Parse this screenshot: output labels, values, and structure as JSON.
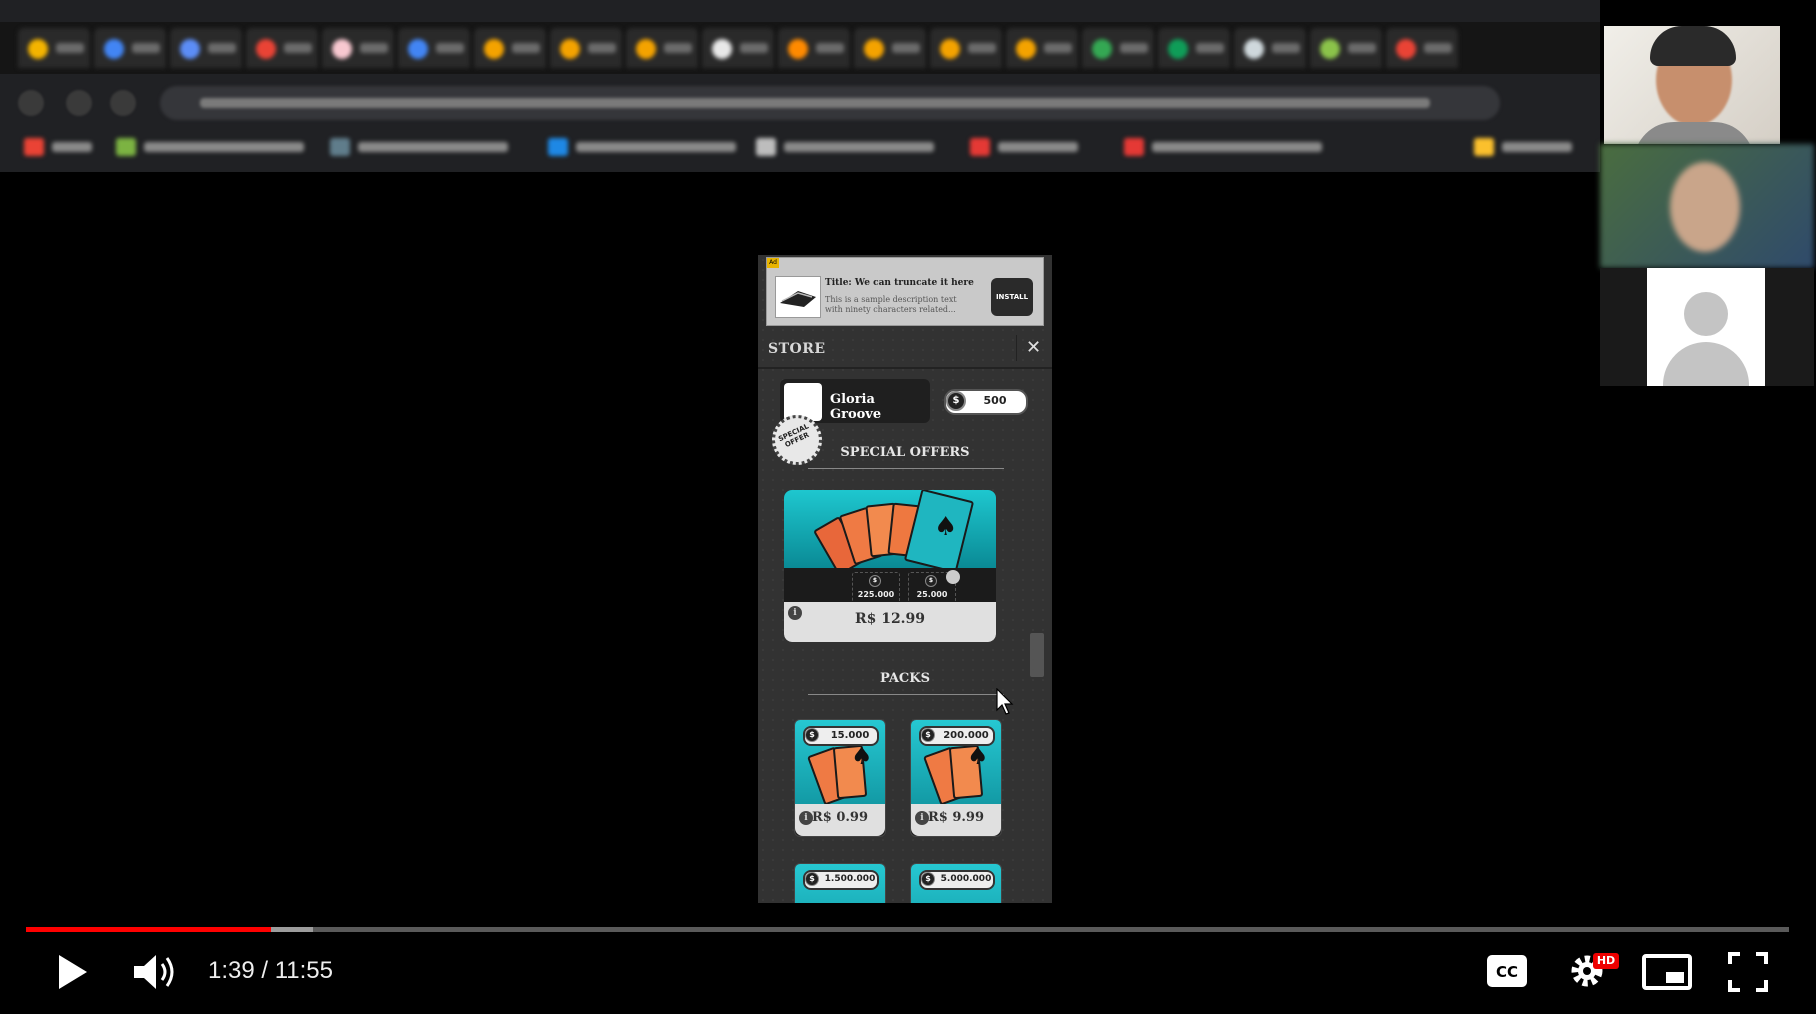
{
  "ad": {
    "badge": "Ad",
    "title": "Title: We can truncate it here",
    "description": "This is a sample description text with ninety characters related...",
    "install_label": "INSTALL"
  },
  "store": {
    "title": "STORE",
    "close_icon": "close-icon"
  },
  "profile": {
    "name": "Gloria Groove",
    "coins": "500"
  },
  "special_offers": {
    "title": "SPECIAL OFFERS",
    "badge": "SPECIAL OFFER",
    "items": [
      {
        "amount": "225.000"
      },
      {
        "amount": "25.000"
      }
    ],
    "price": "R$ 12.99"
  },
  "packs": {
    "title": "PACKS",
    "items": [
      {
        "coins": "15.000",
        "price": "R$ 0.99"
      },
      {
        "coins": "200.000",
        "price": "R$ 9.99"
      },
      {
        "coins": "1.500.000",
        "price": ""
      },
      {
        "coins": "5.000.000",
        "price": ""
      }
    ]
  },
  "video": {
    "time": "1:39 / 11:55",
    "progress": 0.139,
    "buffered": 0.163,
    "hd_badge": "HD",
    "controls": [
      "play-icon",
      "volume-icon",
      "captions-icon",
      "settings-icon",
      "miniplayer-icon",
      "fullscreen-icon"
    ]
  },
  "colors": {
    "progress": "#ff0000",
    "accent_teal": "#1ec7cf"
  }
}
